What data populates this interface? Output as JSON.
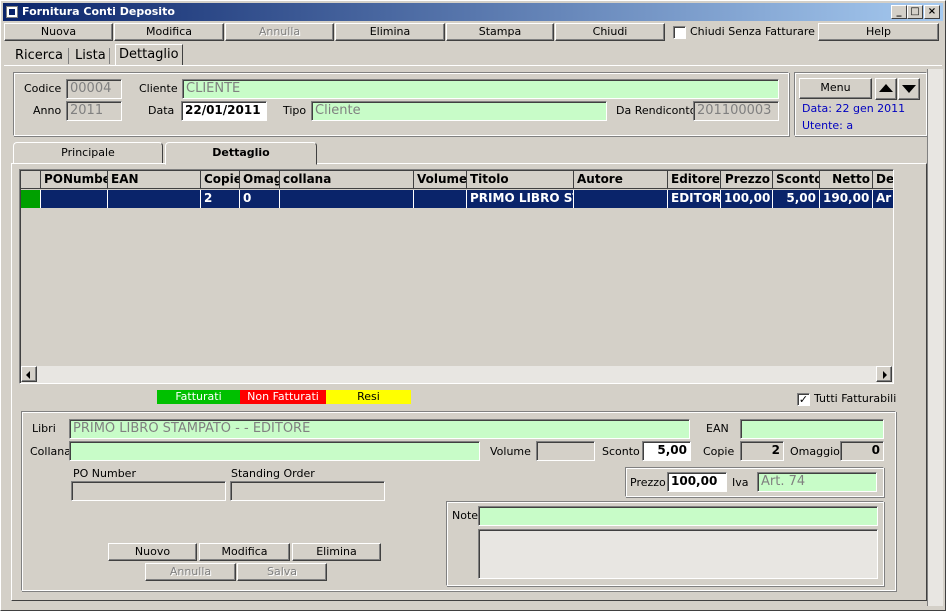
{
  "window": {
    "title": "Fornitura Conti Deposito"
  },
  "toolbar": {
    "nuova": "Nuova",
    "modifica": "Modifica",
    "annulla": "Annulla",
    "elimina": "Elimina",
    "stampa": "Stampa",
    "chiudi": "Chiudi",
    "chiudi_senza_fatturare": "Chiudi Senza Fatturare",
    "help": "Help"
  },
  "main_tabs": [
    "Ricerca",
    "Lista",
    "Dettaglio"
  ],
  "header": {
    "codice_label": "Codice",
    "codice": "00004",
    "cliente_label": "Cliente",
    "cliente": "CLIENTE",
    "anno_label": "Anno",
    "anno": "2011",
    "data_label": "Data",
    "data": "22/01/2011",
    "tipo_label": "Tipo",
    "tipo": "Cliente",
    "da_rendiconto_label": "Da Rendiconto",
    "da_rendiconto": "201100003",
    "menu": "Menu",
    "data_info": "Data: 22 gen 2011",
    "utente_info": "Utente: a"
  },
  "sub_tabs": [
    "Principale",
    "Dettaglio"
  ],
  "grid": {
    "columns": [
      "PONumber",
      "EAN",
      "Copie",
      "Omaggi",
      "collana",
      "Volume",
      "Titolo",
      "Autore",
      "Editore",
      "Prezzo",
      "Sconto",
      "Netto",
      "De"
    ],
    "rows": [
      [
        "",
        "",
        "2",
        "0",
        "",
        "",
        "PRIMO LIBRO ST",
        "",
        "EDITOR",
        "100,00",
        "5,00",
        "190,00",
        "Ar"
      ]
    ]
  },
  "legend": {
    "fatturati": "Fatturati",
    "non_fatturati": "Non Fatturati",
    "resi": "Resi",
    "colors": {
      "fatturati": "#00c000",
      "non_fatturati": "#ff0000",
      "resi": "#ffff00"
    }
  },
  "tutti_fatturabili": "Tutti Fatturabili",
  "detail": {
    "libri_label": "Libri",
    "libri": "PRIMO LIBRO STAMPATO -  - EDITORE",
    "ean_label": "EAN",
    "ean": "",
    "collana_label": "Collana",
    "collana": "",
    "volume_label": "Volume",
    "volume": "",
    "sconto_label": "Sconto",
    "sconto": "5,00",
    "copie_label": "Copie",
    "copie": "2",
    "omaggio_label": "Omaggio",
    "omaggio": "0",
    "po_number_label": "PO Number",
    "po_number": "",
    "standing_order_label": "Standing Order",
    "standing_order": "",
    "prezzo_label": "Prezzo",
    "prezzo": "100,00",
    "iva_label": "Iva",
    "iva": "Art. 74",
    "note_label": "Note",
    "note": ""
  },
  "detail_buttons": {
    "nuovo": "Nuovo",
    "modifica": "Modifica",
    "elimina": "Elimina",
    "annulla": "Annulla",
    "salva": "Salva"
  }
}
